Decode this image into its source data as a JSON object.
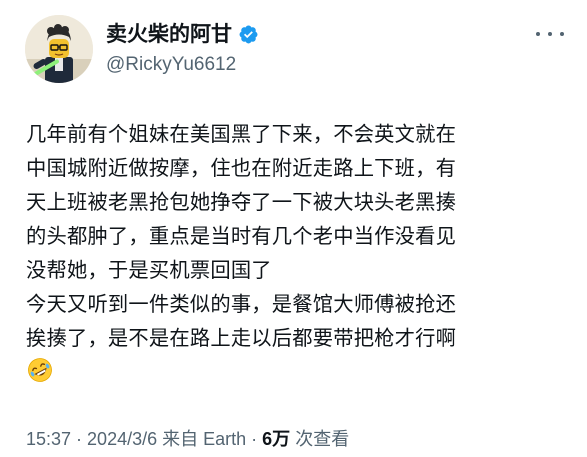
{
  "author": {
    "display_name": "卖火柴的阿甘",
    "handle": "@RickyYu6612",
    "verified": true,
    "verified_color": "#1d9bf0",
    "avatar_icon": "lego-minifigure-avatar"
  },
  "tweet": {
    "lines": [
      "几年前有个姐妹在美国黑了下来，不会英文就在",
      "中国城附近做按摩，住也在附近走路上下班，有",
      "天上班被老黑抢包她挣夺了一下被大块头老黑揍",
      "的头都肿了，重点是当时有几个老中当作没看见",
      "没帮她，于是买机票回国了",
      "今天又听到一件类似的事，是餐馆大师傅被抢还",
      "挨揍了，是不是在路上走以后都要带把枪才行啊"
    ],
    "emoji": "rolling-on-floor-laughing-emoji"
  },
  "meta": {
    "time": "15:37",
    "date": "2024/3/6",
    "source": "来自 Earth",
    "separator": " · ",
    "views_count": "6万",
    "views_label": "次查看"
  },
  "colors": {
    "text_primary": "#0f1419",
    "text_secondary": "#536471"
  }
}
